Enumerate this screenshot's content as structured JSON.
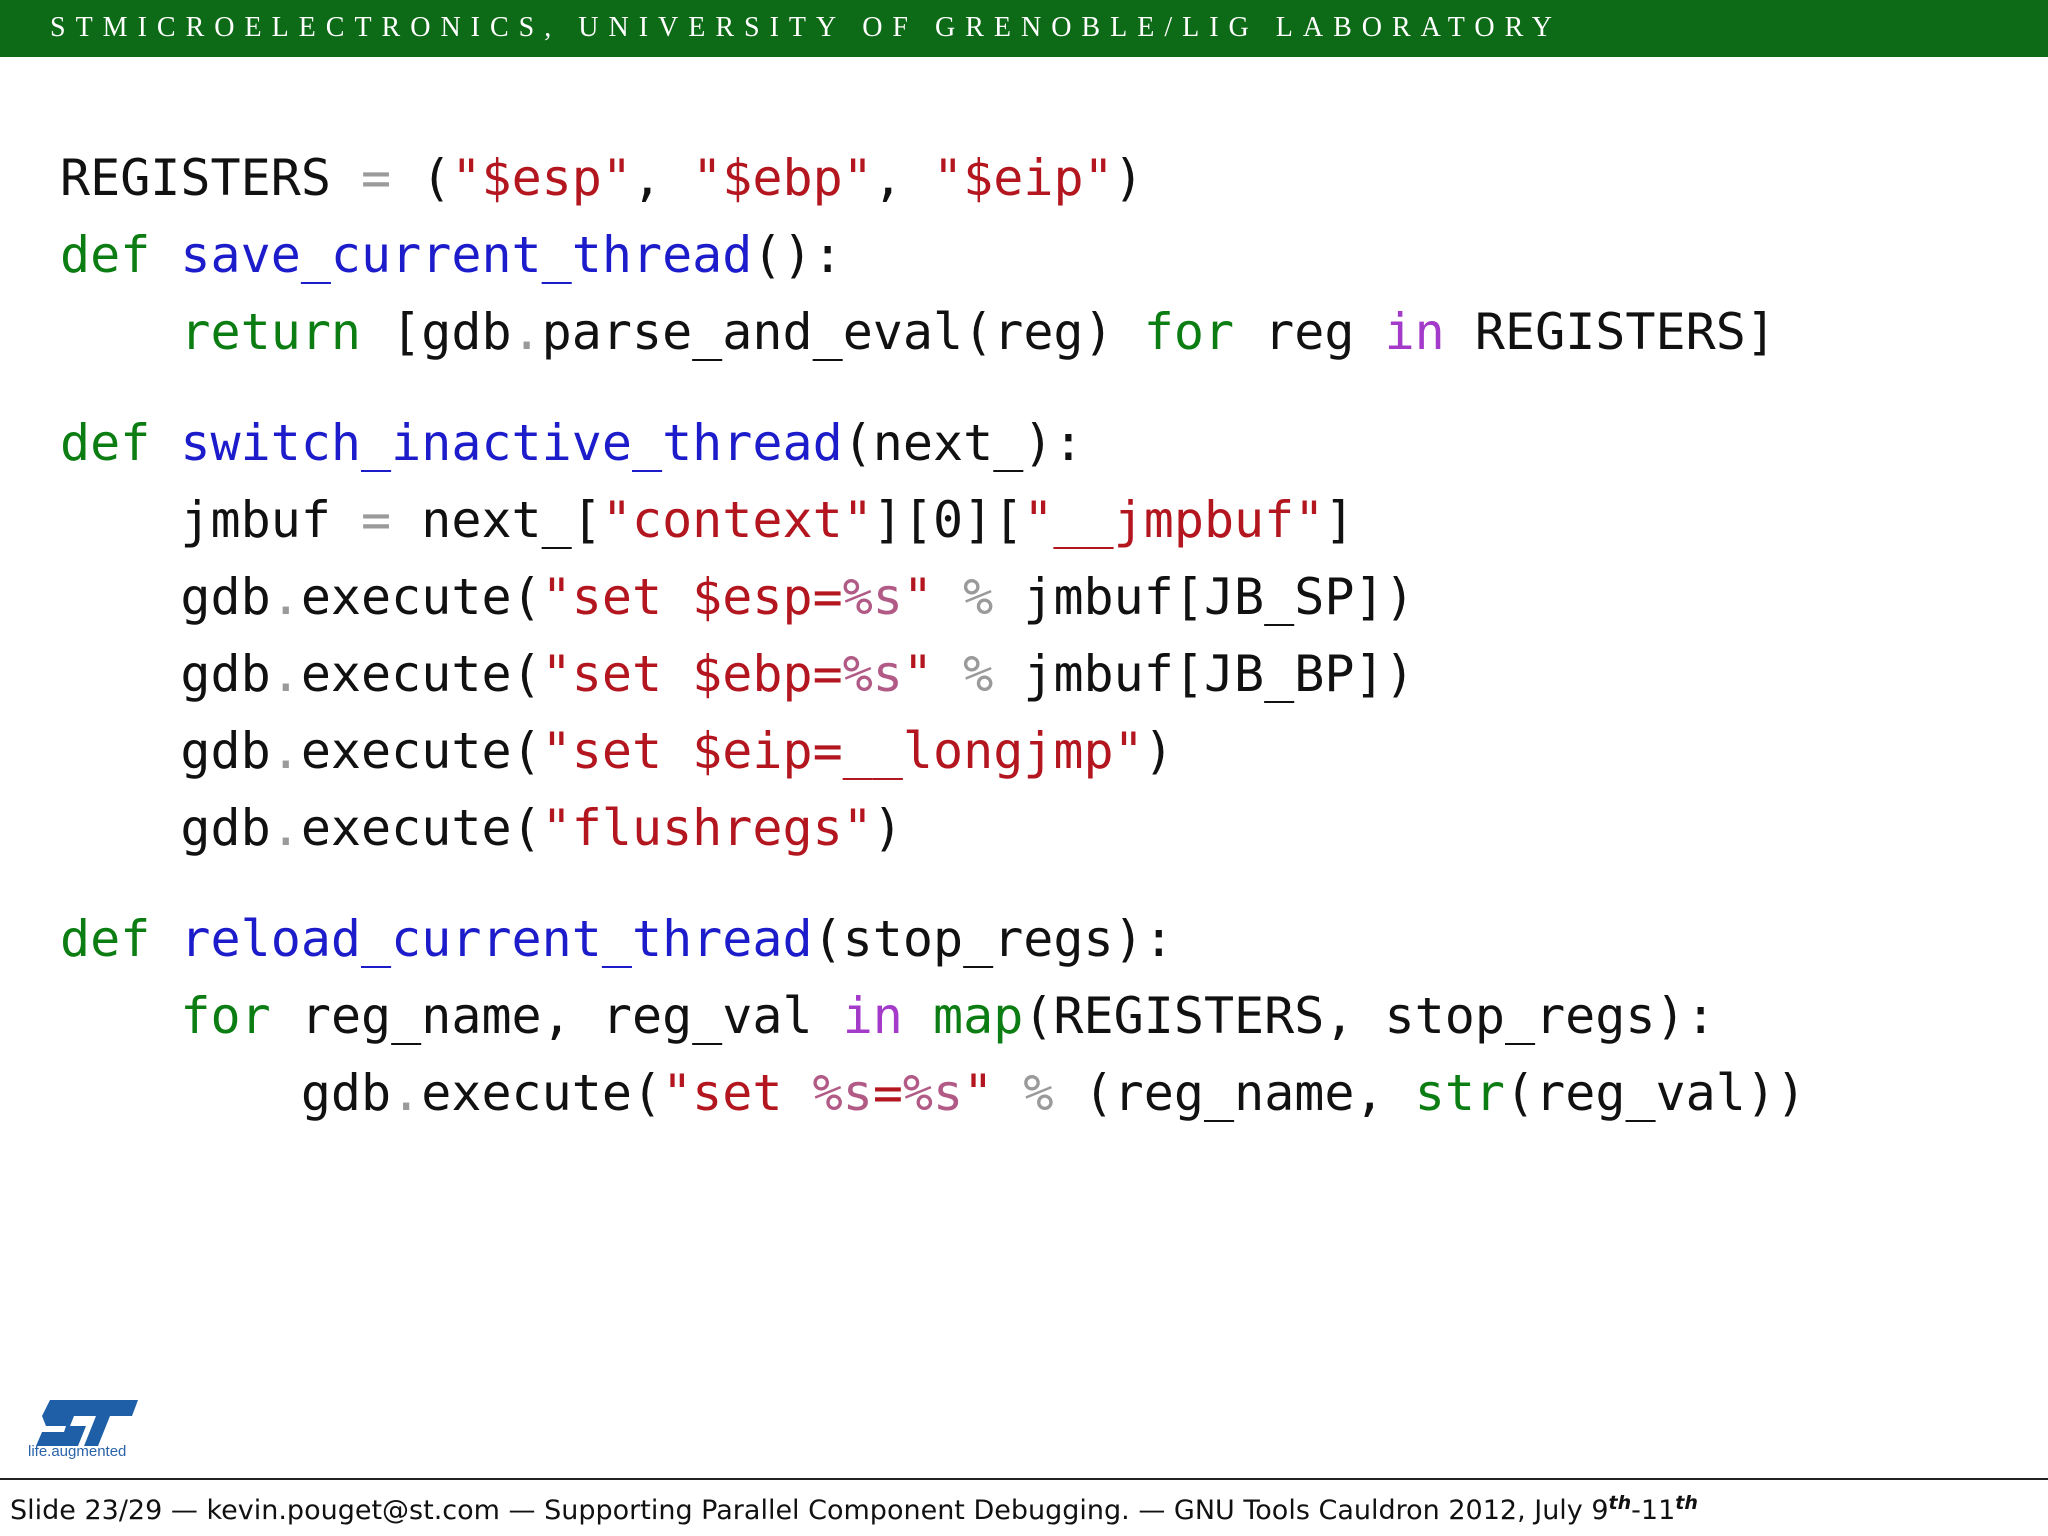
{
  "header": {
    "text": "STMICROELECTRONICS, UNIVERSITY OF GRENOBLE/LIG LABORATORY"
  },
  "code": {
    "lines": [
      [
        [
          "REGISTERS ",
          "p"
        ],
        [
          "= ",
          "op"
        ],
        [
          "(",
          "p"
        ],
        [
          "\"$esp\"",
          "st"
        ],
        [
          ", ",
          "p"
        ],
        [
          "\"$ebp\"",
          "st"
        ],
        [
          ", ",
          "p"
        ],
        [
          "\"$eip\"",
          "st"
        ],
        [
          ")",
          "p"
        ]
      ],
      [
        [
          "def ",
          "kw"
        ],
        [
          "save_current_thread",
          "fn"
        ],
        [
          "():",
          "p"
        ]
      ],
      [
        [
          "    ",
          "p"
        ],
        [
          "return ",
          "kw"
        ],
        [
          "[gdb",
          "p"
        ],
        [
          ".",
          "op"
        ],
        [
          "parse_and_eval(reg) ",
          "p"
        ],
        [
          "for ",
          "kw"
        ],
        [
          "reg ",
          "p"
        ],
        [
          "in ",
          "bi"
        ],
        [
          "REGISTERS]",
          "p"
        ]
      ],
      "gap",
      [
        [
          "def ",
          "kw"
        ],
        [
          "switch_inactive_thread",
          "fn"
        ],
        [
          "(next_):",
          "p"
        ]
      ],
      [
        [
          "    jmbuf ",
          "p"
        ],
        [
          "= ",
          "op"
        ],
        [
          "next_[",
          "p"
        ],
        [
          "\"context\"",
          "st"
        ],
        [
          "][0][",
          "p"
        ],
        [
          "\"__jmpbuf\"",
          "st"
        ],
        [
          "]",
          "p"
        ]
      ],
      [
        [
          "    gdb",
          "p"
        ],
        [
          ".",
          "op"
        ],
        [
          "execute(",
          "p"
        ],
        [
          "\"set $esp=",
          "st"
        ],
        [
          "%s",
          "fmt"
        ],
        [
          "\" ",
          "st"
        ],
        [
          "% ",
          "op"
        ],
        [
          "jmbuf[JB_SP])",
          "p"
        ]
      ],
      [
        [
          "    gdb",
          "p"
        ],
        [
          ".",
          "op"
        ],
        [
          "execute(",
          "p"
        ],
        [
          "\"set $ebp=",
          "st"
        ],
        [
          "%s",
          "fmt"
        ],
        [
          "\" ",
          "st"
        ],
        [
          "% ",
          "op"
        ],
        [
          "jmbuf[JB_BP])",
          "p"
        ]
      ],
      [
        [
          "    gdb",
          "p"
        ],
        [
          ".",
          "op"
        ],
        [
          "execute(",
          "p"
        ],
        [
          "\"set $eip=__longjmp\"",
          "st"
        ],
        [
          ")",
          "p"
        ]
      ],
      [
        [
          "    gdb",
          "p"
        ],
        [
          ".",
          "op"
        ],
        [
          "execute(",
          "p"
        ],
        [
          "\"flushregs\"",
          "st"
        ],
        [
          ")",
          "p"
        ]
      ],
      "gap",
      [
        [
          "def ",
          "kw"
        ],
        [
          "reload_current_thread",
          "fn"
        ],
        [
          "(stop_regs):",
          "p"
        ]
      ],
      [
        [
          "    ",
          "p"
        ],
        [
          "for ",
          "kw"
        ],
        [
          "reg_name, reg_val ",
          "p"
        ],
        [
          "in ",
          "bi"
        ],
        [
          "map",
          "kw"
        ],
        [
          "(REGISTERS, stop_regs):",
          "p"
        ]
      ],
      [
        [
          "        gdb",
          "p"
        ],
        [
          ".",
          "op"
        ],
        [
          "execute(",
          "p"
        ],
        [
          "\"set ",
          "st"
        ],
        [
          "%s",
          "fmt"
        ],
        [
          "=",
          "st"
        ],
        [
          "%s",
          "fmt"
        ],
        [
          "\" ",
          "st"
        ],
        [
          "% ",
          "op"
        ],
        [
          "(reg_name, ",
          "p"
        ],
        [
          "str",
          "kw"
        ],
        [
          "(reg_val))",
          "p"
        ]
      ]
    ]
  },
  "logo": {
    "mark": "ST",
    "tagline": "life.augmented"
  },
  "footer": {
    "slide": "Slide 23/29",
    "sep": " — ",
    "email": "kevin.pouget@st.com",
    "title": "Supporting Parallel Component Debugging.",
    "event": "GNU Tools Cauldron 2012, July 9",
    "sup1": "th",
    "dash": "-11",
    "sup2": "th"
  }
}
